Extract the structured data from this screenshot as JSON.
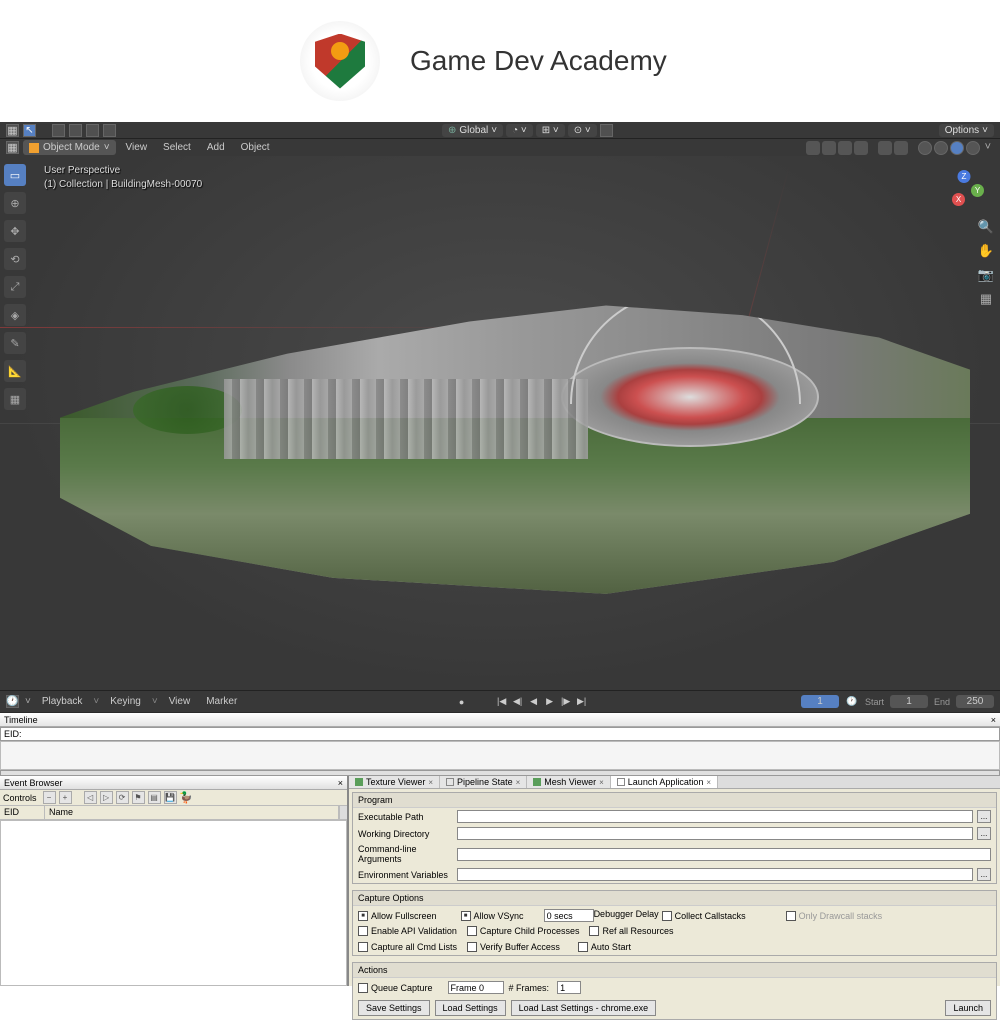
{
  "header": {
    "title": "Game Dev Academy"
  },
  "blender": {
    "mode": "Object Mode",
    "menus": [
      "View",
      "Select",
      "Add",
      "Object"
    ],
    "orientation": "Global",
    "options": "Options",
    "viewport": {
      "perspective": "User Perspective",
      "collection": "(1) Collection | BuildingMesh-00070"
    },
    "gizmo": {
      "x": "X",
      "y": "Y",
      "z": "Z"
    },
    "timeline": {
      "menus": [
        "Playback",
        "Keying",
        "View",
        "Marker"
      ],
      "current": "1",
      "start_label": "Start",
      "start": "1",
      "end_label": "End",
      "end": "250"
    }
  },
  "renderdoc": {
    "timeline_title": "Timeline",
    "eid_label": "EID:",
    "event_browser": {
      "title": "Event Browser",
      "controls": "Controls",
      "cols": {
        "eid": "EID",
        "name": "Name"
      }
    },
    "tabs": [
      {
        "label": "Texture Viewer",
        "ico": "green"
      },
      {
        "label": "Pipeline State",
        "ico": "clear"
      },
      {
        "label": "Mesh Viewer",
        "ico": "green"
      },
      {
        "label": "Launch Application",
        "ico": "clear",
        "active": true
      }
    ],
    "program": {
      "title": "Program",
      "exe": "Executable Path",
      "wd": "Working Directory",
      "args": "Command-line Arguments",
      "env": "Environment Variables"
    },
    "capture_options": {
      "title": "Capture Options",
      "allow_fullscreen": "Allow Fullscreen",
      "allow_vsync": "Allow VSync",
      "dbg_delay_val": "0 secs",
      "dbg_delay": "Debugger Delay",
      "collect_callstacks": "Collect Callstacks",
      "only_drawcall": "Only Drawcall stacks",
      "enable_api_val": "Enable API Validation",
      "capture_child": "Capture Child Processes",
      "ref_all": "Ref all Resources",
      "capture_cmd": "Capture all Cmd Lists",
      "verify_buffer": "Verify Buffer Access",
      "auto_start": "Auto Start"
    },
    "actions": {
      "title": "Actions",
      "queue_capture": "Queue Capture",
      "frame_label": "Frame 0",
      "num_frames_label": "# Frames:",
      "num_frames": "1",
      "save": "Save Settings",
      "load": "Load Settings",
      "load_last": "Load Last Settings - chrome.exe",
      "launch": "Launch"
    }
  }
}
